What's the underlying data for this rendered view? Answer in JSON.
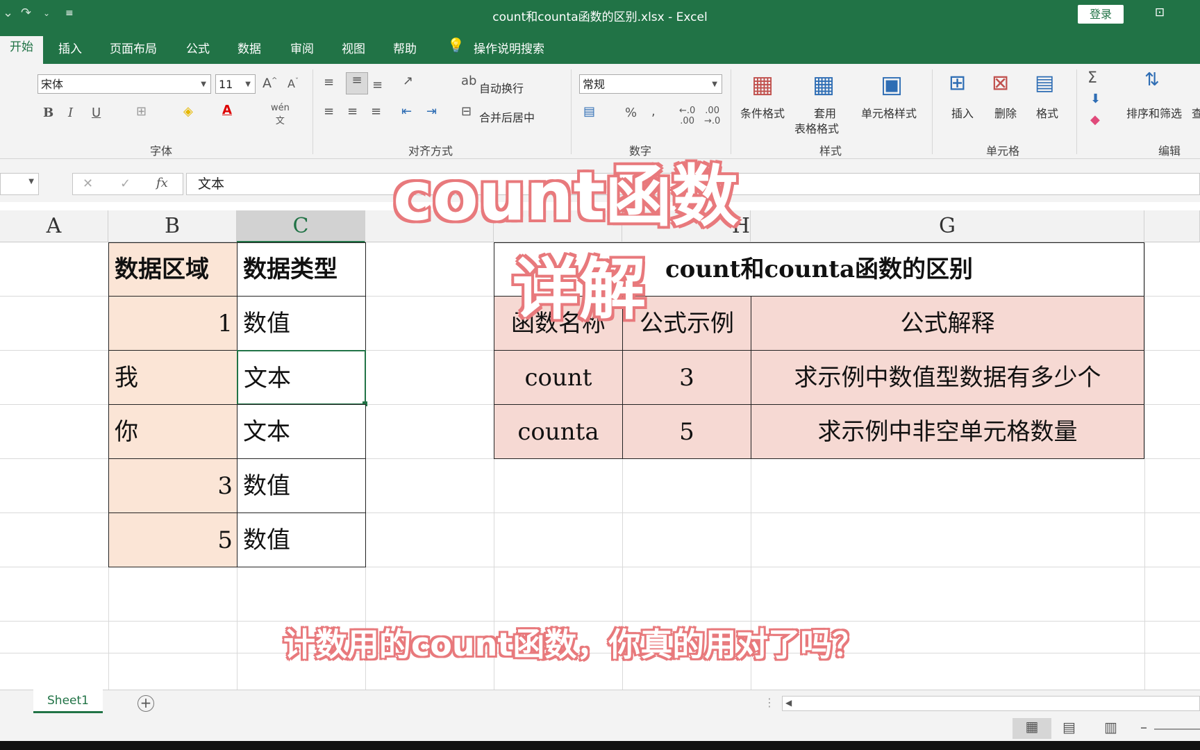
{
  "window": {
    "title": "count和counta函数的区别.xlsx  -  Excel",
    "login_label": "登录"
  },
  "tabs": [
    "开始",
    "插入",
    "页面布局",
    "公式",
    "数据",
    "审阅",
    "视图",
    "帮助",
    "操作说明搜索"
  ],
  "ribbon": {
    "font_name": "宋体",
    "font_size": "11",
    "wrap_text": "自动换行",
    "merge_center": "合并后居中",
    "number_format": "常规",
    "conditional_format": "条件格式",
    "table_format_line1": "套用",
    "table_format_line2": "表格格式",
    "cell_styles": "单元格样式",
    "insert": "插入",
    "delete": "删除",
    "format": "格式",
    "sort_filter": "排序和筛选",
    "find_partial": "查",
    "groups": {
      "font": "字体",
      "alignment": "对齐方式",
      "number": "数字",
      "styles": "样式",
      "cells": "单元格",
      "editing": "编辑"
    }
  },
  "formula_bar": {
    "value": "文本"
  },
  "columns": [
    "A",
    "B",
    "C",
    "H",
    "G"
  ],
  "left_table": {
    "header_b": "数据区域",
    "header_c": "数据类型",
    "rows": [
      {
        "b": "1",
        "c": "数值",
        "b_align": "right"
      },
      {
        "b": "我",
        "c": "文本",
        "b_align": "left"
      },
      {
        "b": "你",
        "c": "文本",
        "b_align": "left"
      },
      {
        "b": "3",
        "c": "数值",
        "b_align": "right"
      },
      {
        "b": "5",
        "c": "数值",
        "b_align": "right"
      }
    ]
  },
  "right_table": {
    "title": "count和counta函数的区别",
    "headers": [
      "函数名称",
      "公式示例",
      "公式解释"
    ],
    "rows": [
      [
        "count",
        "3",
        "求示例中数值型数据有多少个"
      ],
      [
        "counta",
        "5",
        "求示例中非空单元格数量"
      ]
    ]
  },
  "overlay": {
    "title_line1": "count函数",
    "title_line2": "详解",
    "subtitle": "计数用的count函数，你真的用对了吗？"
  },
  "sheet": {
    "tab": "Sheet1"
  },
  "colors": {
    "excel_green": "#217346",
    "overlay_pink": "#e8797c",
    "b_fill": "#fbe5d6",
    "table_fill": "#f6d9d3"
  }
}
